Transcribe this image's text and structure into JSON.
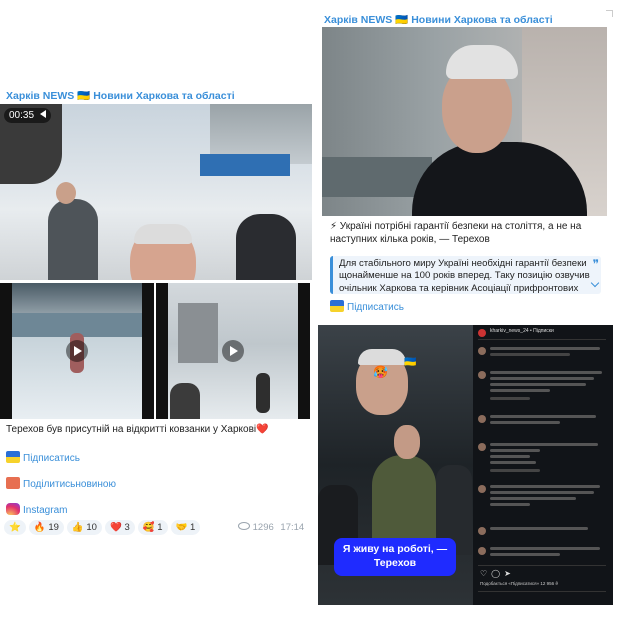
{
  "left_post": {
    "channel_name": "Харків NEWS 🇺🇦 Новини Харкова та області",
    "video_time": "00:35",
    "caption": "Терехов був присутній на відкритті ковзанки у Харкові❤️",
    "subscribe_link": "Підписатись",
    "share_link": "Поділитисьновиною",
    "instagram_link": "Instagram",
    "reactions": [
      {
        "emoji": "⭐",
        "count": ""
      },
      {
        "emoji": "🔥",
        "count": "19"
      },
      {
        "emoji": "👍",
        "count": "10"
      },
      {
        "emoji": "❤️",
        "count": "3"
      },
      {
        "emoji": "🥰",
        "count": "1"
      },
      {
        "emoji": "🤝",
        "count": "1"
      }
    ],
    "views": "1296",
    "time": "17:14"
  },
  "right_post": {
    "channel_name": "Харків NEWS 🇺🇦 Новини Харкова та області",
    "headline": "⚡ Україні потрібні гарантії безпеки на століття, а не на наступних кілька років, — Терехов",
    "quote": "Для стабільного миру Україні необхідні гарантії безпеки щонайменше на 100 років вперед. Таку позицію озвучив очільник Харкова та керівник Асоціації прифронтових міст і",
    "subscribe_link": "Підписатись"
  },
  "instagram_screenshot": {
    "overlay_text": "Я живу на роботі, — Терехов",
    "account": "kharkiv_news_24 • Підписки",
    "likes_text": "Подобається «Підписатися» 12 956 ϑ"
  },
  "colors": {
    "accent": "#3a8fd9",
    "overlay_blue": "#1f2bff",
    "dark_bg": "#111418"
  }
}
